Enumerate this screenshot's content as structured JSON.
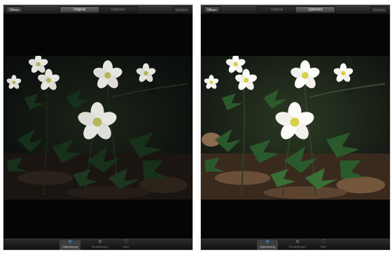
{
  "screens": [
    {
      "open_label": "Öffnen",
      "segments": [
        "Original",
        "Optimiert"
      ],
      "active_segment": 0,
      "save_label": "Sichern",
      "tabs": [
        {
          "label": "Optimierung",
          "icon": "wand-icon"
        },
        {
          "label": "Einstellungen",
          "icon": "settings-icon"
        },
        {
          "label": "Über",
          "icon": "info-icon"
        }
      ],
      "active_tab": 0
    },
    {
      "open_label": "Öffnen",
      "segments": [
        "Original",
        "Optimiert"
      ],
      "active_segment": 1,
      "save_label": "Sichern",
      "tabs": [
        {
          "label": "Optimierung",
          "icon": "wand-icon"
        },
        {
          "label": "Einstellungen",
          "icon": "settings-icon"
        },
        {
          "label": "Über",
          "icon": "info-icon"
        }
      ],
      "active_tab": 0
    }
  ],
  "colors": {
    "accent": "#3ea0ff",
    "background": "#050505"
  }
}
